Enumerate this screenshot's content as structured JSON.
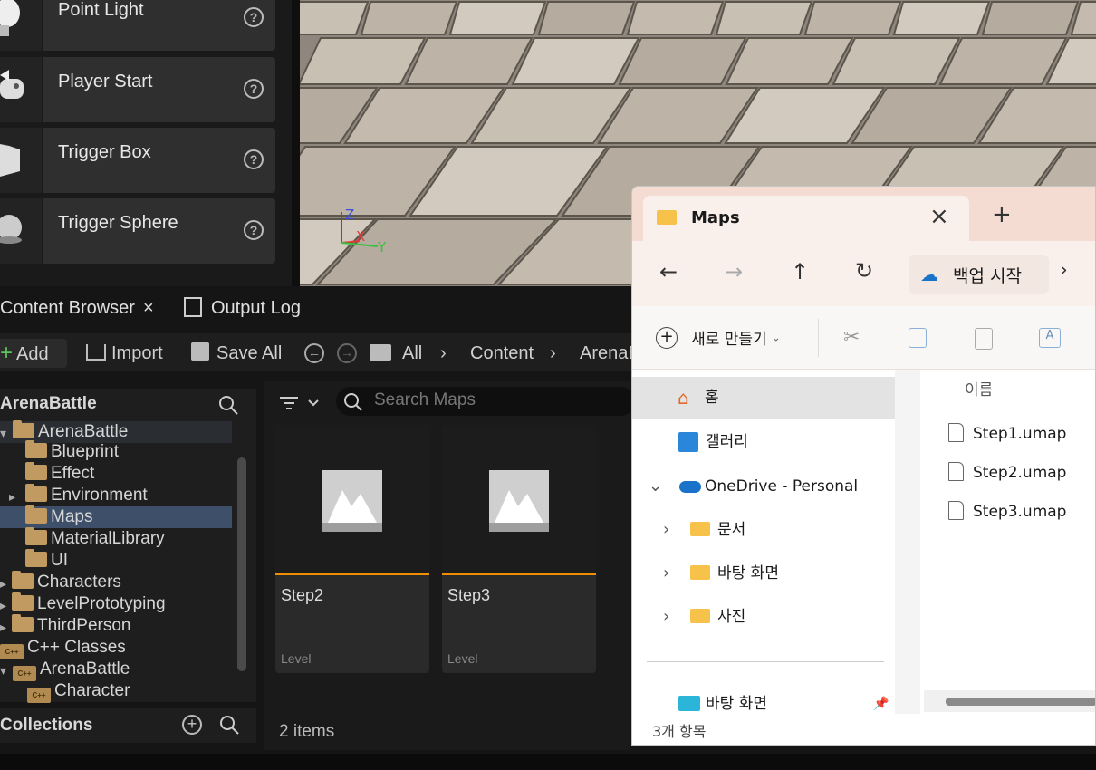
{
  "place_actors": {
    "items": [
      {
        "label": "Point Light",
        "icon": "point-light-icon"
      },
      {
        "label": "Player Start",
        "icon": "player-start-icon"
      },
      {
        "label": "Trigger Box",
        "icon": "trigger-box-icon"
      },
      {
        "label": "Trigger Sphere",
        "icon": "trigger-sphere-icon"
      }
    ],
    "help_glyph": "?"
  },
  "viewport": {
    "axis_z": "Z",
    "axis_x": "X",
    "axis_y": "Y"
  },
  "tabs": {
    "content_browser": "Content Browser",
    "close": "×",
    "output_log": "Output Log"
  },
  "toolbar": {
    "add_label": "Add",
    "import_label": "Import",
    "save_all_label": "Save All",
    "breadcrumb": [
      "All",
      "Content",
      "ArenaBattle"
    ]
  },
  "tree": {
    "header": "ArenaBattle",
    "items": [
      "ArenaBattle",
      "Blueprint",
      "Effect",
      "Environment",
      "Maps",
      "MaterialLibrary",
      "UI",
      "Characters",
      "LevelPrototyping",
      "ThirdPerson",
      "C++ Classes",
      "ArenaBattle",
      "Character"
    ],
    "selected": "Maps",
    "cpp_badge": "C++"
  },
  "collections": {
    "label": "Collections"
  },
  "assets": {
    "search_placeholder": "Search Maps",
    "tiles": [
      {
        "name": "Step2",
        "type": "Level"
      },
      {
        "name": "Step3",
        "type": "Level"
      }
    ],
    "count": "2 items"
  },
  "explorer": {
    "tab_title": "Maps",
    "close": "×",
    "new_tab": "+",
    "backup_label": "백업 시작",
    "new_label": "새로 만들기",
    "nav_items": [
      {
        "label": "홈"
      },
      {
        "label": "갤러리"
      },
      {
        "label": "OneDrive - Personal"
      },
      {
        "label": "문서"
      },
      {
        "label": "바탕 화면"
      },
      {
        "label": "사진"
      },
      {
        "label": "바탕 화면"
      }
    ],
    "column_name": "이름",
    "files": [
      "Step1.umap",
      "Step2.umap",
      "Step3.umap"
    ],
    "status": "3개 항목"
  },
  "colors": {
    "accent_orange": "#f08d00",
    "ue_bg": "#151515",
    "explorer_title": "#f4dcd3"
  }
}
